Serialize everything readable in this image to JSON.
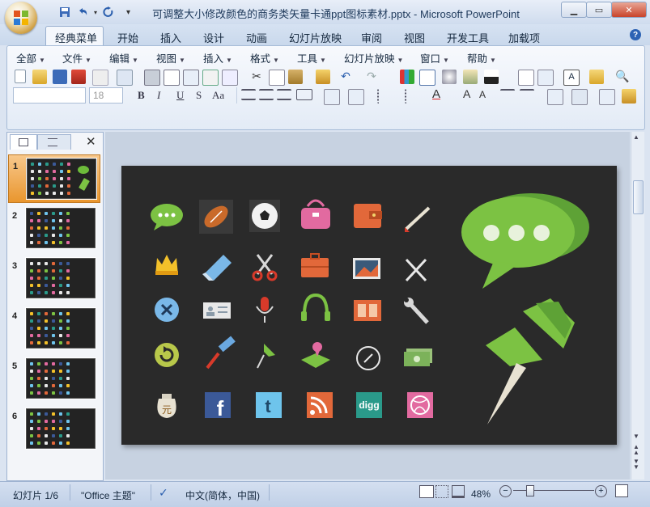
{
  "window": {
    "title": "可调整大小修改颜色的商务类矢量卡通ppt图标素材.pptx - Microsoft PowerPoint"
  },
  "ribbon_tabs": [
    "经典菜单",
    "开始",
    "插入",
    "设计",
    "动画",
    "幻灯片放映",
    "审阅",
    "视图",
    "开发工具",
    "加载项"
  ],
  "active_tab": "经典菜单",
  "menus": [
    "全部",
    "文件",
    "编辑",
    "视图",
    "插入",
    "格式",
    "工具",
    "幻灯片放映",
    "窗口",
    "帮助"
  ],
  "font_size_value": "18",
  "format_buttons": [
    "B",
    "I",
    "U",
    "S",
    "Aa"
  ],
  "slides": [
    {
      "number": "1",
      "selected": true
    },
    {
      "number": "2",
      "selected": false
    },
    {
      "number": "3",
      "selected": false
    },
    {
      "number": "4",
      "selected": false
    },
    {
      "number": "5",
      "selected": false
    },
    {
      "number": "6",
      "selected": false
    }
  ],
  "slide_icons": {
    "digg_text": "digg",
    "moneybag_text": "元",
    "facebook_text": "f",
    "twitter_text": "t"
  },
  "status": {
    "slide_indicator": "幻灯片 1/6",
    "theme": "\"Office 主题\"",
    "language": "中文(简体，中国)",
    "zoom": "48%"
  },
  "colors": {
    "slide_bg": "#2a2a2a",
    "accent_green": "#7cc243",
    "selection_orange": "#e9962e"
  }
}
